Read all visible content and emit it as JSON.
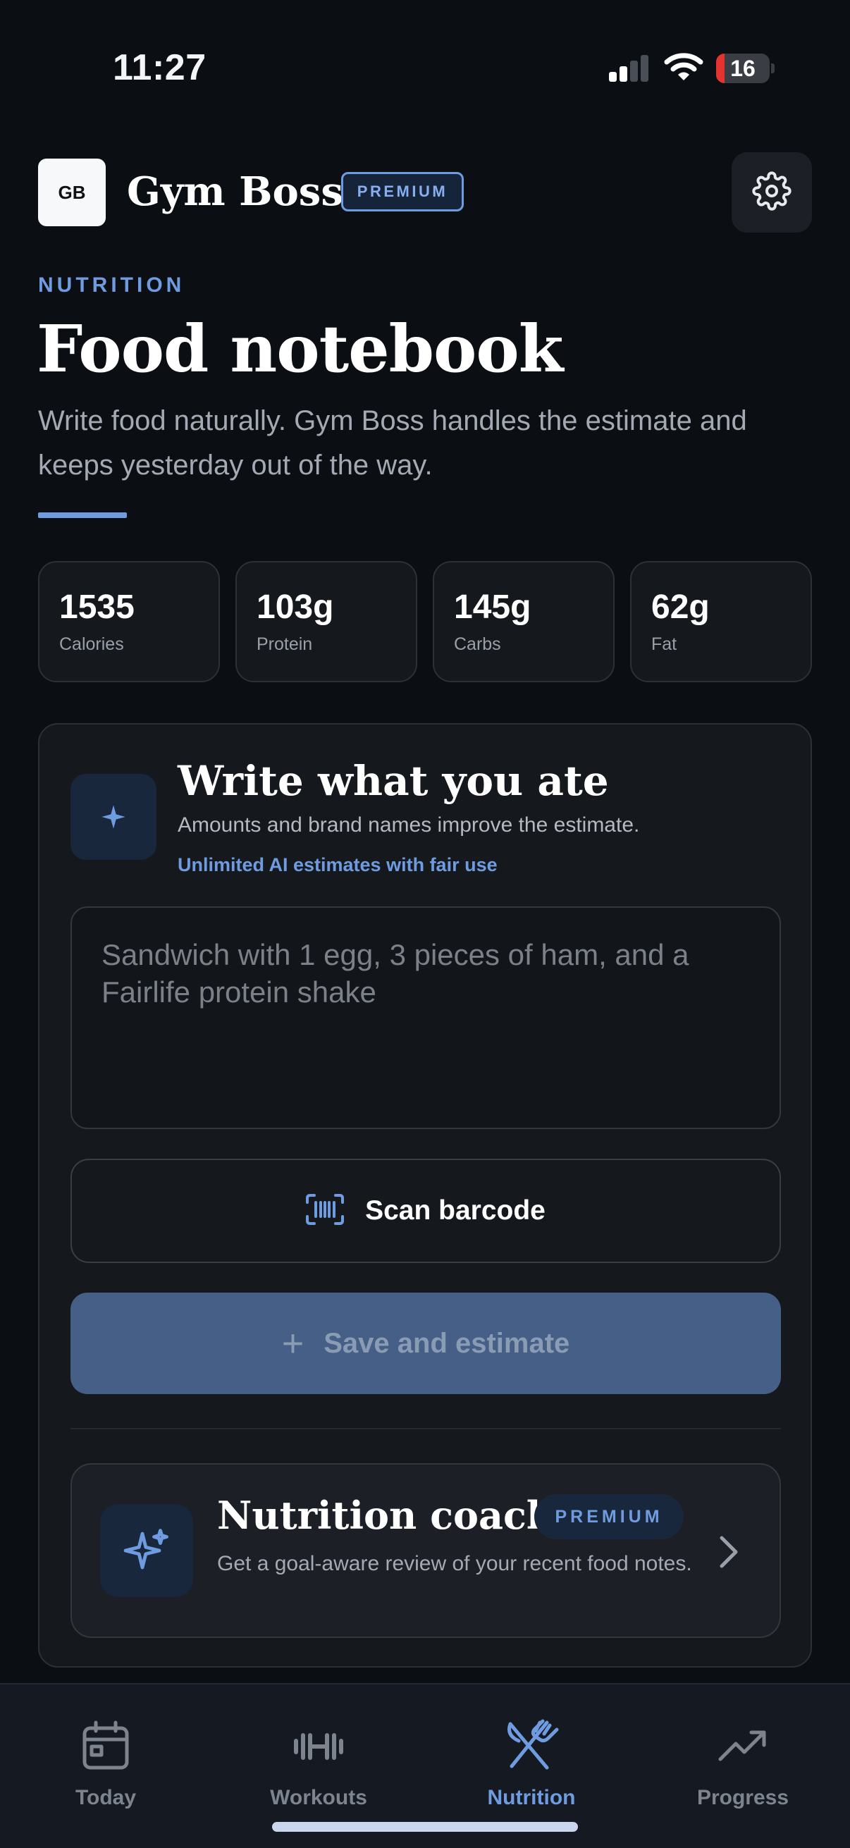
{
  "status_bar": {
    "time": "11:27",
    "battery": "16"
  },
  "header": {
    "logo": "GB",
    "app_name": "Gym Boss",
    "plan_badge": "PREMIUM",
    "settings_icon": "gear-icon"
  },
  "intro": {
    "eyebrow": "NUTRITION",
    "title": "Food notebook",
    "description": "Write food naturally. Gym Boss handles the estimate and keeps yesterday out of the way."
  },
  "stats": [
    {
      "value": "1535",
      "label": "Calories"
    },
    {
      "value": "103g",
      "label": "Protein"
    },
    {
      "value": "145g",
      "label": "Carbs"
    },
    {
      "value": "62g",
      "label": "Fat"
    }
  ],
  "entry": {
    "title": "Write what you ate",
    "description": "Amounts and brand names improve the estimate.",
    "fair_use_note": "Unlimited AI estimates with fair use",
    "input_value": "",
    "input_placeholder": "Sandwich with 1 egg, 3 pieces of ham, and a Fairlife protein shake",
    "scan_label": "Scan barcode",
    "save_label": "Save and estimate"
  },
  "coach": {
    "title": "Nutrition coach",
    "badge": "PREMIUM",
    "description": "Get a goal-aware review of your recent food notes."
  },
  "nav": {
    "items": [
      {
        "label": "Today",
        "icon": "calendar-icon",
        "active": false
      },
      {
        "label": "Workouts",
        "icon": "dumbbell-icon",
        "active": false
      },
      {
        "label": "Nutrition",
        "icon": "fork-knife-icon",
        "active": true
      },
      {
        "label": "Progress",
        "icon": "trending-up-icon",
        "active": false
      }
    ]
  },
  "colors": {
    "background": "#0b0e13",
    "card": "#15181d",
    "accent": "#6f9ce0",
    "save_button": "#455f86",
    "battery_low": "#e5342f"
  }
}
